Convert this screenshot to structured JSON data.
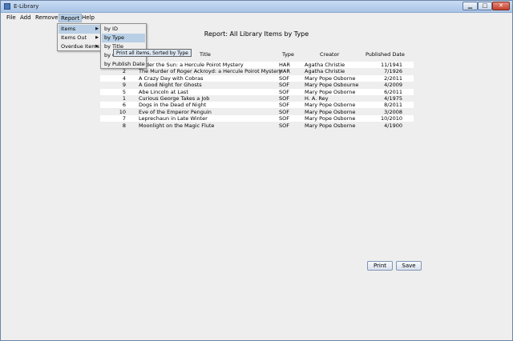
{
  "window": {
    "title": "E-Library"
  },
  "menubar": {
    "file": "File",
    "add": "Add",
    "remove": "Remove",
    "report": "Report",
    "help": "Help"
  },
  "report_menu": {
    "items": "Items",
    "items_out": "Items Out",
    "overdue_items": "Overdue Items"
  },
  "items_submenu": {
    "by_id": "by ID",
    "by_type": "by Type",
    "by_title": "by Title",
    "by_creator": "by C",
    "by_publish_date": "by Publish Date"
  },
  "tooltip": "Print all items, Sorted by Type",
  "report": {
    "title": "Report: All Library Items by Type",
    "columns": {
      "title": "Title",
      "type": "Type",
      "creator": "Creator",
      "published": "Published Date"
    },
    "rows": [
      {
        "id": "3",
        "title": "Under the Sun: a Hercule Poirot Mystery",
        "type": "HAR",
        "creator": "Agatha Christie",
        "date": "11/1941"
      },
      {
        "id": "2",
        "title": "The Murder of Roger Ackroyd: a Hercule Poirot Mystery",
        "type": "HAR",
        "creator": "Agatha Christie",
        "date": "7/1926"
      },
      {
        "id": "4",
        "title": "A Crazy Day with Cobras",
        "type": "SOF",
        "creator": "Mary Pope Osborne",
        "date": "2/2011"
      },
      {
        "id": "9",
        "title": "A Good Night for Ghosts",
        "type": "SOF",
        "creator": "Mary Pope Osbourne",
        "date": "4/2009"
      },
      {
        "id": "5",
        "title": "Abe Lincoln at Last",
        "type": "SOF",
        "creator": "Mary Pope Osborne",
        "date": "6/2011"
      },
      {
        "id": "1",
        "title": "Curious George Takes a Job",
        "type": "SOF",
        "creator": "H. A. Rey",
        "date": "4/1975"
      },
      {
        "id": "6",
        "title": "Dogs in the Dead of Night",
        "type": "SOF",
        "creator": "Mary Pope Osborne",
        "date": "8/2011"
      },
      {
        "id": "10",
        "title": "Eve of the Emperor Penguin",
        "type": "SOF",
        "creator": "Mary Pope Osborne",
        "date": "3/2008"
      },
      {
        "id": "7",
        "title": "Leprechaun in Late Winter",
        "type": "SOF",
        "creator": "Mary Pope Osborne",
        "date": "10/2010"
      },
      {
        "id": "8",
        "title": "Moonlight on the Magic Flute",
        "type": "SOF",
        "creator": "Mary Pope Osborne",
        "date": "4/1900"
      }
    ]
  },
  "buttons": {
    "print": "Print",
    "save": "Save"
  }
}
